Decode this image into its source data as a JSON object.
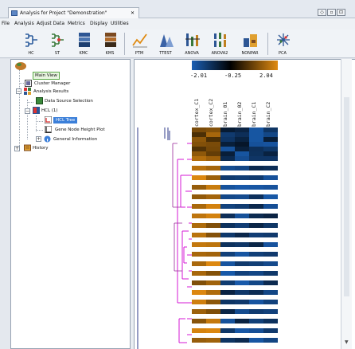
{
  "window": {
    "tab_title": "Analysis for Project \"Demonstration\"",
    "tab_close": "✕",
    "buttons": [
      "◇",
      "▫",
      "⊡"
    ]
  },
  "menu": [
    "File",
    "Analysis",
    "Adjust Data",
    "Metrics",
    "Display",
    "Utilities"
  ],
  "toolbar": [
    {
      "label": "HC",
      "icon": "hierarchical-tree-icon"
    },
    {
      "label": "ST",
      "icon": "support-tree-icon"
    },
    {
      "label": "KMC",
      "icon": "kmeans-cluster-icon"
    },
    {
      "label": "KMS",
      "icon": "kmeans-support-icon"
    },
    {
      "label": "PTM",
      "icon": "template-match-icon"
    },
    {
      "label": "TTEST",
      "icon": "ttest-icon"
    },
    {
      "label": "ANOVA",
      "icon": "anova-icon"
    },
    {
      "label": "ANOVA2",
      "icon": "two-factor-anova-icon"
    },
    {
      "label": "NONPAR",
      "icon": "nonparametric-icon"
    },
    {
      "label": "PCA",
      "icon": "pca-icon"
    }
  ],
  "tree": {
    "main_view": "Main View",
    "cluster_manager": "Cluster Manager",
    "analysis_results": "Analysis Results",
    "data_source_selection": "Data Source Selection",
    "hcl": "HCL (1)",
    "hcl_tree": "HCL Tree",
    "gene_node_height_plot": "Gene Node Height Plot",
    "general_information": "General Information",
    "history": "History"
  },
  "heatmap": {
    "scale_labels": [
      "-2.01",
      "-0.25",
      "2.04"
    ],
    "columns": [
      "cortex_C1",
      "cortex_C2",
      "brain_01",
      "brain_02",
      "brain_C1",
      "brain_C2"
    ],
    "colors": {
      "low": "#1a5fb4",
      "mid": "#000000",
      "high": "#e08a10"
    }
  }
}
